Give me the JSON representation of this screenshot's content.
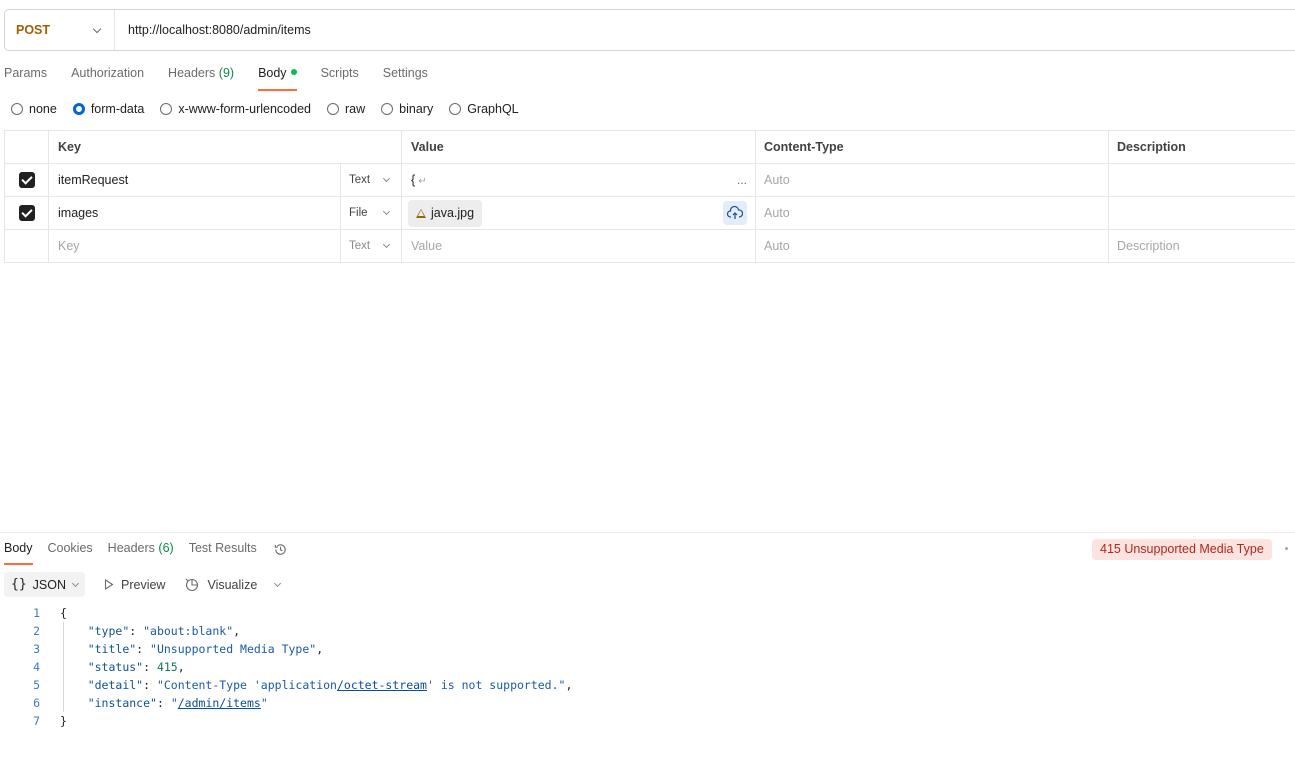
{
  "request": {
    "method": "POST",
    "url": "http://localhost:8080/admin/items"
  },
  "request_tabs": [
    {
      "label": "Params"
    },
    {
      "label": "Authorization"
    },
    {
      "label": "Headers",
      "count": "(9)"
    },
    {
      "label": "Body",
      "active": true
    },
    {
      "label": "Scripts"
    },
    {
      "label": "Settings"
    }
  ],
  "body_modes": [
    "none",
    "form-data",
    "x-www-form-urlencoded",
    "raw",
    "binary",
    "GraphQL"
  ],
  "body_mode_selected": "form-data",
  "params_table": {
    "headers": {
      "key": "Key",
      "value": "Value",
      "content_type": "Content-Type",
      "description": "Description"
    },
    "rows": [
      {
        "key": "itemRequest",
        "type": "Text",
        "value": "{",
        "value_suffix": "↵",
        "value_more": "...",
        "content_type": "Auto",
        "description": "",
        "checked": true
      },
      {
        "key": "images",
        "type": "File",
        "file": "java.jpg",
        "content_type": "Auto",
        "description": "",
        "checked": true
      }
    ],
    "empty_row": {
      "key": "Key",
      "type": "Text",
      "value": "Value",
      "content_type": "Auto",
      "description": "Description"
    }
  },
  "response_tabs": [
    {
      "label": "Body",
      "active": true
    },
    {
      "label": "Cookies"
    },
    {
      "label": "Headers",
      "count": "(6)"
    },
    {
      "label": "Test Results"
    }
  ],
  "status": "415 Unsupported Media Type",
  "viewbar": {
    "format": "JSON",
    "format_icon": "{}",
    "preview": "Preview",
    "visualize": "Visualize"
  },
  "code_lines": [
    {
      "n": "1",
      "text": "{"
    },
    {
      "n": "2",
      "key": "\"type\"",
      "value": "\"about:blank\"",
      "trail": ","
    },
    {
      "n": "3",
      "key": "\"title\"",
      "value": "\"Unsupported Media Type\"",
      "trail": ","
    },
    {
      "n": "4",
      "key": "\"status\"",
      "value": "415",
      "trail": ","
    },
    {
      "n": "5",
      "key": "\"detail\"",
      "value_a": "\"Content-Type 'application",
      "value_link": "/octet-stream",
      "value_b": "' is not supported.\"",
      "trail": ","
    },
    {
      "n": "6",
      "key": "\"instance\"",
      "value_a": "\"",
      "value_link": "/admin/items",
      "value_b": "\"",
      "trail": ""
    },
    {
      "n": "7",
      "text": "}"
    }
  ],
  "colors": {
    "accent": "#ff6c37",
    "radio": "#0265d2",
    "status_bg": "#fbe4e0",
    "status_text": "#b3261e",
    "method": "#a35d00"
  }
}
